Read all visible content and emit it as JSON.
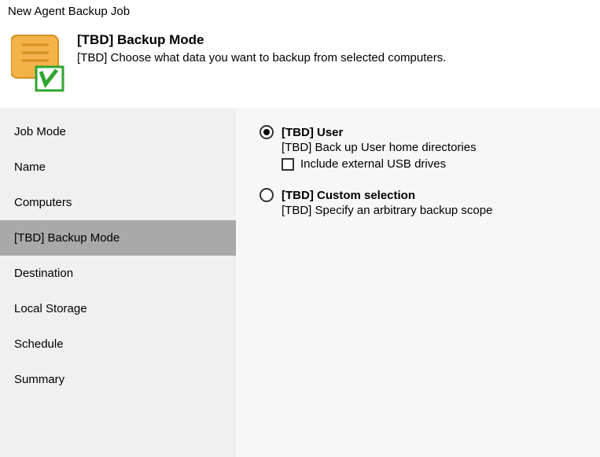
{
  "window": {
    "title": "New Agent Backup Job"
  },
  "header": {
    "title": "[TBD] Backup Mode",
    "description": "[TBD] Choose what data you want to backup from selected computers."
  },
  "sidebar": {
    "items": [
      {
        "label": "Job Mode",
        "selected": false
      },
      {
        "label": "Name",
        "selected": false
      },
      {
        "label": "Computers",
        "selected": false
      },
      {
        "label": "[TBD] Backup Mode",
        "selected": true
      },
      {
        "label": "Destination",
        "selected": false
      },
      {
        "label": "Local Storage",
        "selected": false
      },
      {
        "label": "Schedule",
        "selected": false
      },
      {
        "label": "Summary",
        "selected": false
      }
    ]
  },
  "options": {
    "user": {
      "title": "[TBD] User",
      "description": "[TBD] Back up User home directories",
      "checked": true,
      "include_usb": {
        "label": "Include external USB drives",
        "checked": false
      }
    },
    "custom": {
      "title": "[TBD] Custom selection",
      "description": "[TBD] Specify an arbitrary backup scope",
      "checked": false
    }
  },
  "colors": {
    "sidebar_bg": "#f0f0f0",
    "sidebar_selected": "#a9a9a9",
    "content_bg": "#f7f7f7",
    "icon_scroll_fill": "#f4b34a",
    "icon_scroll_stroke": "#d68f1f",
    "icon_badge_stroke": "#2fa52f"
  }
}
